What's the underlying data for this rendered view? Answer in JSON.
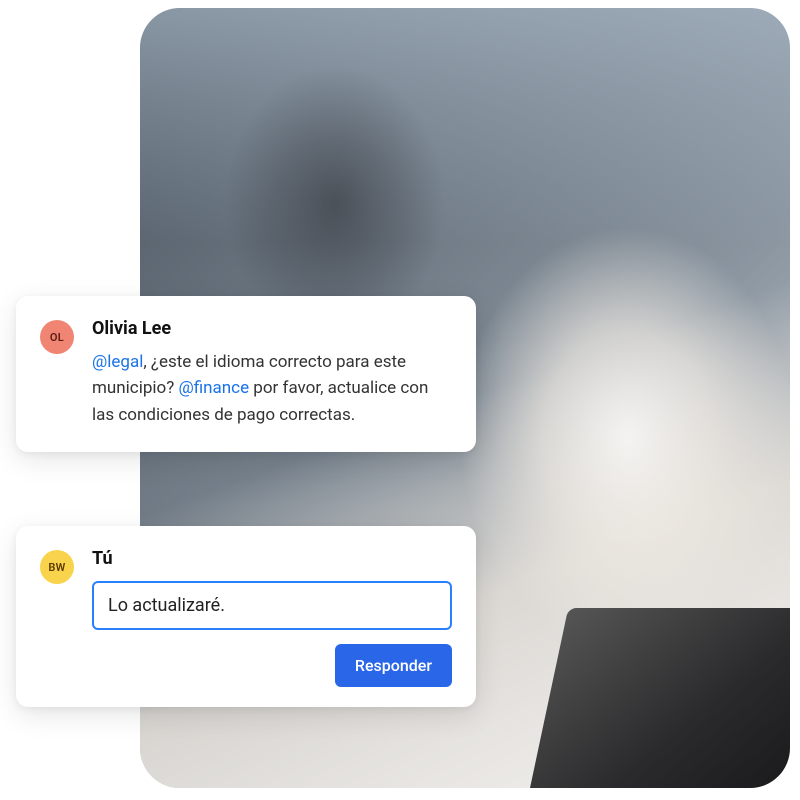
{
  "comments": [
    {
      "avatar_initials": "OL",
      "author": "Olivia Lee",
      "message": {
        "parts": [
          {
            "type": "mention",
            "text": "@legal"
          },
          {
            "type": "text",
            "text": ", ¿este el idioma correcto para este municipio? "
          },
          {
            "type": "mention",
            "text": "@finance"
          },
          {
            "type": "text",
            "text": " por favor, actualice con las condiciones de pago correctas."
          }
        ]
      }
    }
  ],
  "reply": {
    "avatar_initials": "BW",
    "author": "Tú",
    "input_value": "Lo actualizaré. ",
    "button_label": "Responder"
  }
}
